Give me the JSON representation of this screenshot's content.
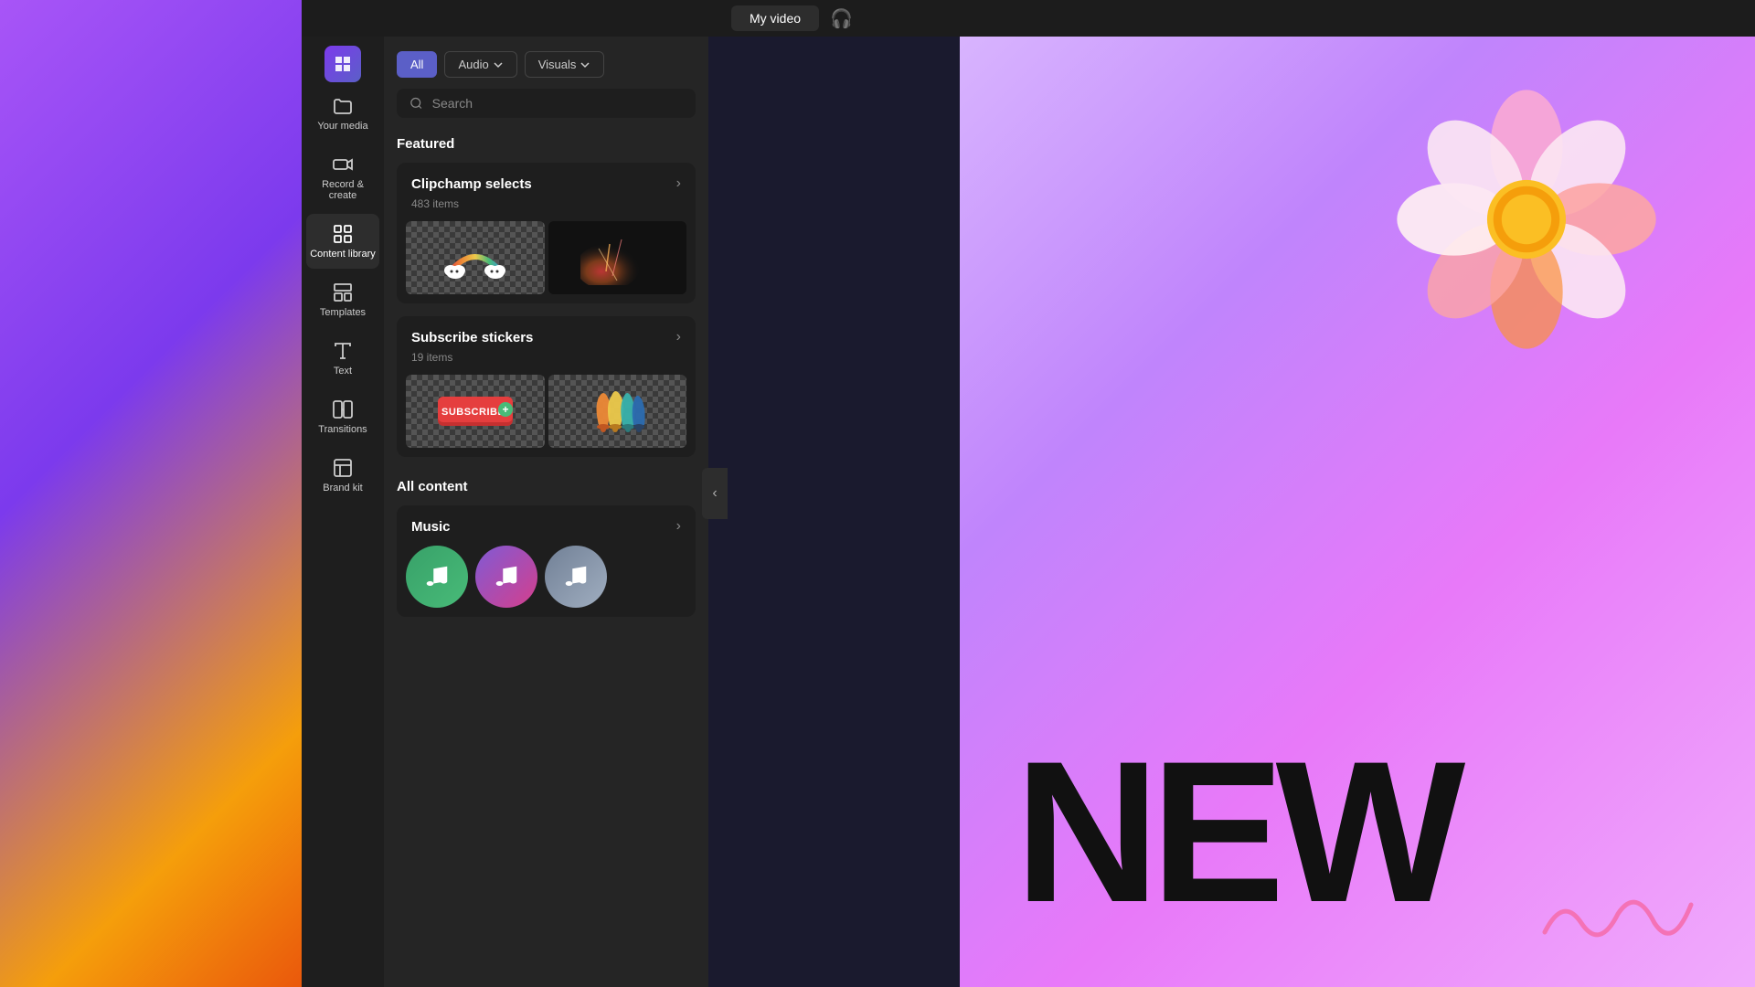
{
  "app": {
    "title": "Clipchamp"
  },
  "topbar": {
    "my_video_label": "My video"
  },
  "sidebar": {
    "items": [
      {
        "id": "your-media",
        "label": "Your media",
        "icon": "folder"
      },
      {
        "id": "record-create",
        "label": "Record &\ncreate",
        "icon": "video"
      },
      {
        "id": "content-library",
        "label": "Content library",
        "icon": "grid",
        "active": true
      },
      {
        "id": "templates",
        "label": "Templates",
        "icon": "layout"
      },
      {
        "id": "text",
        "label": "Text",
        "icon": "text"
      },
      {
        "id": "transitions",
        "label": "Transitions",
        "icon": "transitions"
      },
      {
        "id": "brand-kit",
        "label": "Brand kit",
        "icon": "brand"
      }
    ]
  },
  "filters": {
    "all_label": "All",
    "audio_label": "Audio",
    "visuals_label": "Visuals"
  },
  "search": {
    "placeholder": "Search"
  },
  "featured": {
    "title": "Featured",
    "cards": [
      {
        "id": "clipchamp-selects",
        "title": "Clipchamp selects",
        "subtitle": "483 items"
      },
      {
        "id": "subscribe-stickers",
        "title": "Subscribe stickers",
        "subtitle": "19 items"
      }
    ]
  },
  "all_content": {
    "title": "All content",
    "sections": [
      {
        "id": "music",
        "title": "Music"
      }
    ]
  },
  "canvas": {
    "text": "NEW"
  }
}
